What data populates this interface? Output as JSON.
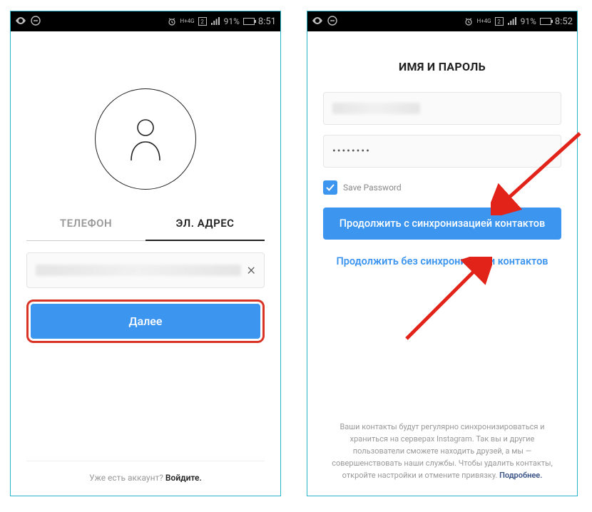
{
  "statusbar": {
    "battery_pct_left": "91%",
    "time_left": "8:51",
    "battery_pct_right": "91%",
    "time_right": "8:52",
    "net_label": "H+",
    "net_sub": "4G",
    "sim_label": "2"
  },
  "screen1": {
    "tab_phone": "ТЕЛЕФОН",
    "tab_email": "ЭЛ. АДРЕС",
    "next_button": "Далее",
    "footer_prefix": "Уже есть аккаунт? ",
    "footer_link": "Войдите."
  },
  "screen2": {
    "heading": "ИМЯ И ПАРОЛЬ",
    "password_masked": "••••••••",
    "save_password_label": "Save Password",
    "primary_button": "Продолжить с синхронизацией контактов",
    "secondary_link": "Продолжить без синхронизации контактов",
    "disclaimer": "Ваши контакты будут регулярно синхронизироваться и храниться на серверах Instagram. Так вы и другие пользователи сможете находить друзей, а мы — совершенствовать наши службы. Чтобы удалить контакты, откройте настройки и отмените привязку. ",
    "disclaimer_more": "Подробнее."
  }
}
